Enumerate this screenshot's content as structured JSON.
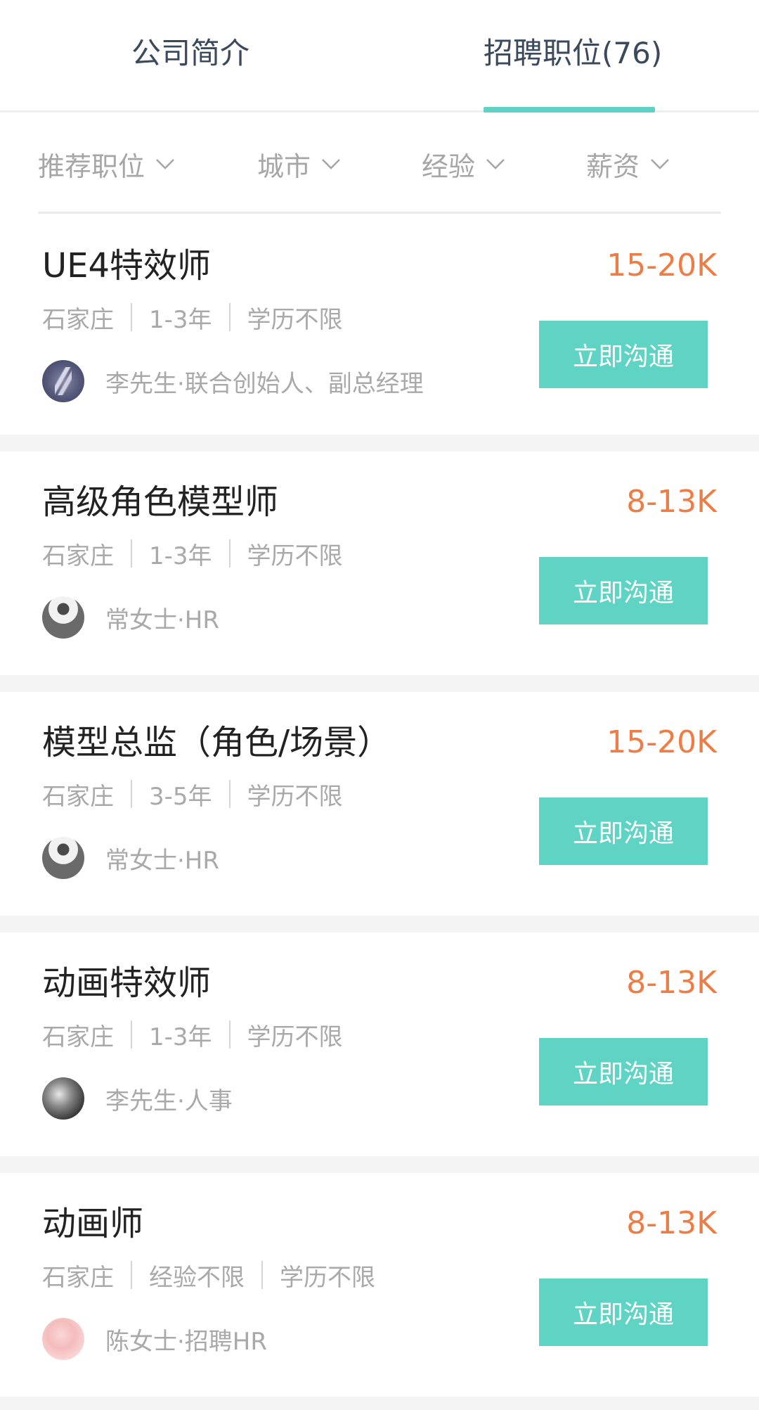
{
  "tabs": [
    {
      "label": "公司简介",
      "active": false
    },
    {
      "label": "招聘职位(76)",
      "active": true
    }
  ],
  "filters": [
    {
      "label": "推荐职位"
    },
    {
      "label": "城市"
    },
    {
      "label": "经验"
    },
    {
      "label": "薪资"
    }
  ],
  "colors": {
    "accent": "#5fd4c5",
    "salary": "#ee7c45",
    "muted_text": "#a9a9a9",
    "title_text": "#222222"
  },
  "jobs": [
    {
      "title": "UE4特效师",
      "salary": "15-20K",
      "city": "石家庄",
      "experience": "1-3年",
      "education": "学历不限",
      "recruiter": "李先生·联合创始人、副总经理",
      "button": "立即沟通"
    },
    {
      "title": "高级角色模型师",
      "salary": "8-13K",
      "city": "石家庄",
      "experience": "1-3年",
      "education": "学历不限",
      "recruiter": "常女士·HR",
      "button": "立即沟通"
    },
    {
      "title": "模型总监（角色/场景）",
      "salary": "15-20K",
      "city": "石家庄",
      "experience": "3-5年",
      "education": "学历不限",
      "recruiter": "常女士·HR",
      "button": "立即沟通"
    },
    {
      "title": "动画特效师",
      "salary": "8-13K",
      "city": "石家庄",
      "experience": "1-3年",
      "education": "学历不限",
      "recruiter": "李先生·人事",
      "button": "立即沟通"
    },
    {
      "title": "动画师",
      "salary": "8-13K",
      "city": "石家庄",
      "experience": "经验不限",
      "education": "学历不限",
      "recruiter": "陈女士·招聘HR",
      "button": "立即沟通"
    }
  ]
}
